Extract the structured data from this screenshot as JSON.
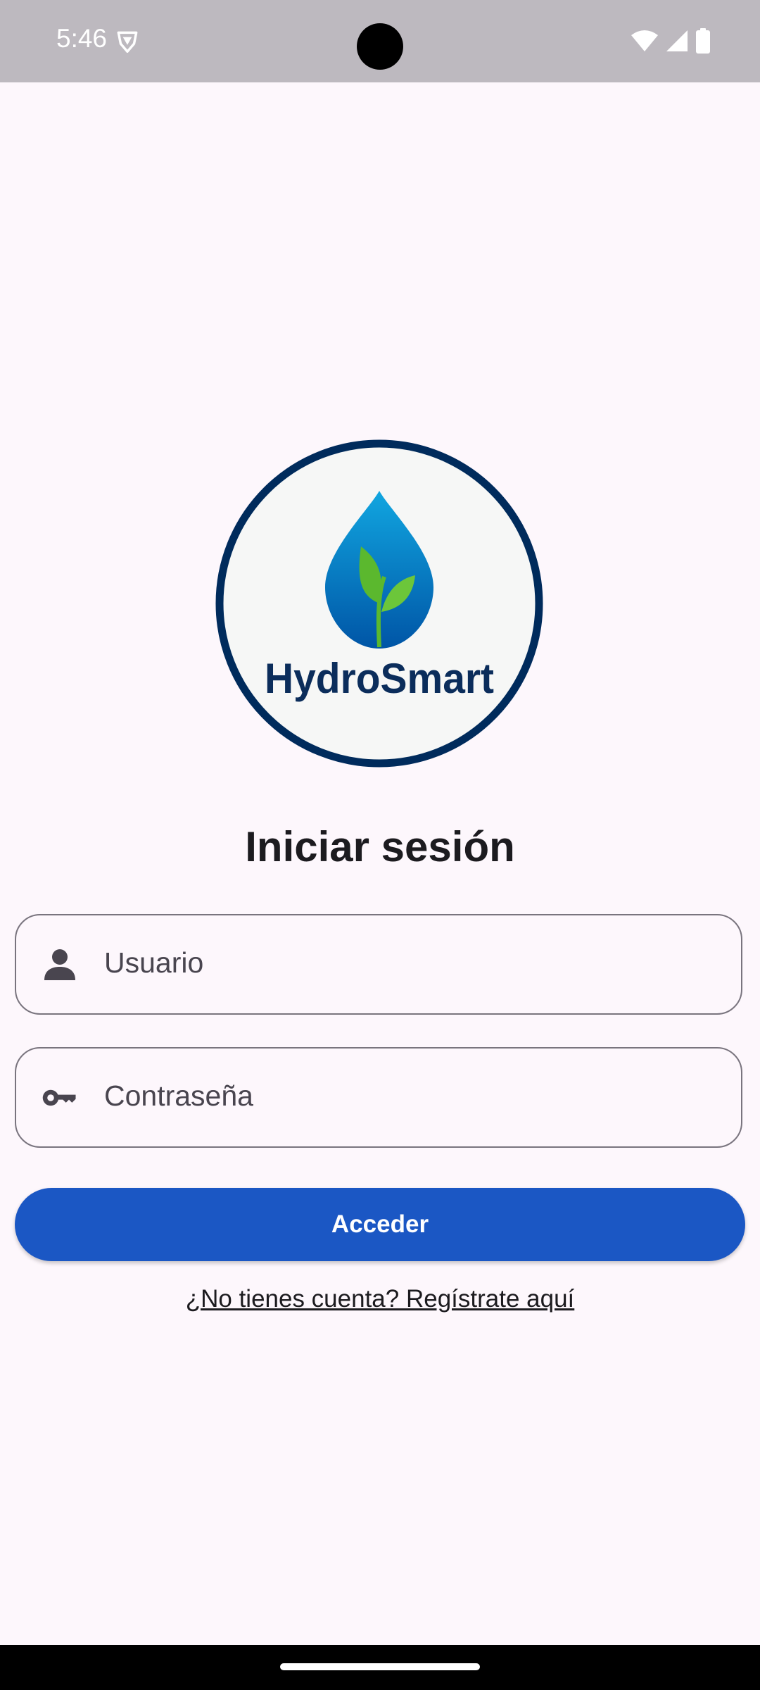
{
  "status_bar": {
    "time": "5:46",
    "icons": [
      "shield-icon",
      "wifi-icon",
      "signal-icon",
      "battery-icon"
    ]
  },
  "logo": {
    "brand_text": "HydroSmart",
    "colors": {
      "ring": "#002b5c",
      "drop_light": "#0c9bd9",
      "drop_dark": "#0057a8",
      "leaf": "#5bb82e",
      "text": "#0b2d5b"
    }
  },
  "login": {
    "title": "Iniciar sesión",
    "username_placeholder": "Usuario",
    "password_placeholder": "Contraseña",
    "submit_label": "Acceder",
    "register_link": "¿No tienes cuenta? Regístrate aquí"
  },
  "colors": {
    "background": "#fdf7fc",
    "primary": "#1b57c4",
    "status_bar": "#bdb9bf"
  }
}
